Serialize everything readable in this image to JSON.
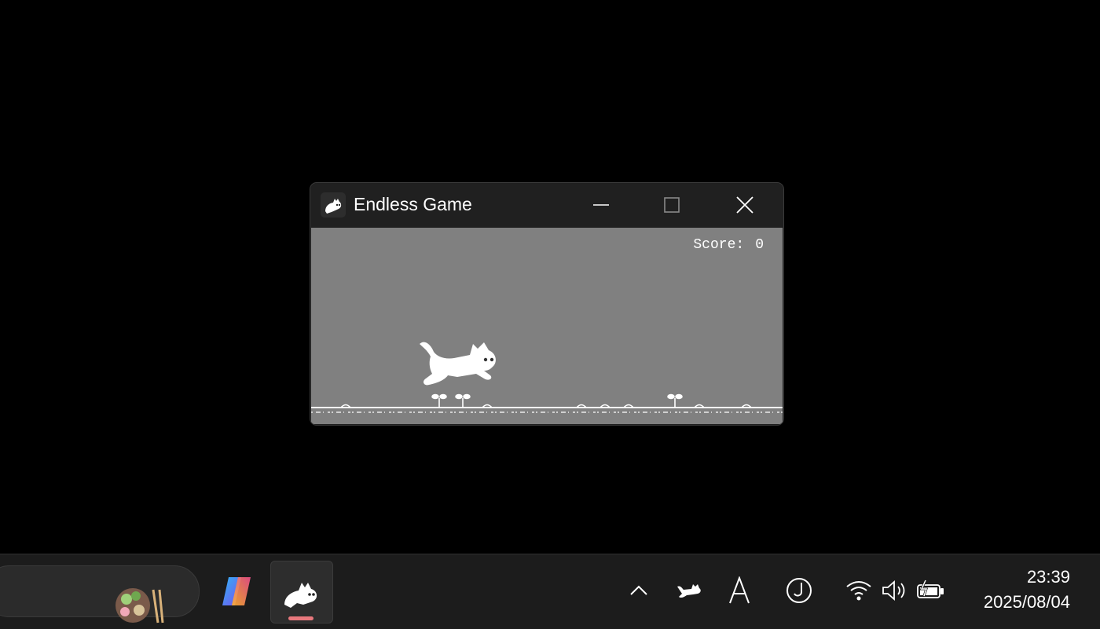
{
  "window": {
    "title": "Endless Game",
    "minimize_label": "Minimize",
    "maximize_label": "Maximize",
    "close_label": "Close"
  },
  "game": {
    "score_label": "Score:",
    "score_value": "0"
  },
  "taskbar": {
    "apps": [
      {
        "name": "Copilot"
      },
      {
        "name": "Endless Game",
        "running": true
      }
    ],
    "tray": [
      "chevron-up-icon",
      "running-cat-icon",
      "ime-a-icon",
      "ime-j-icon",
      "wifi-icon",
      "volume-icon",
      "battery-charging-icon"
    ],
    "clock": {
      "time": "23:39",
      "date": "2025/08/04"
    },
    "running_indicator_color": "#e8787d"
  }
}
